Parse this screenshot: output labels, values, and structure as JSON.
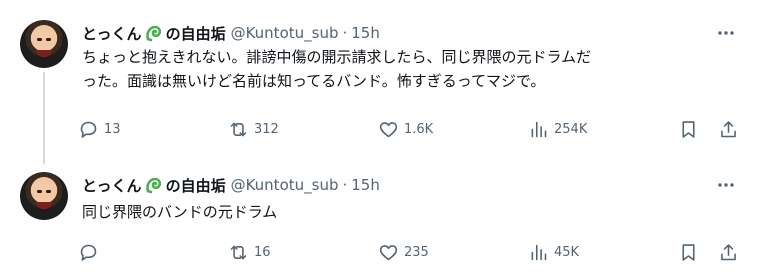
{
  "posts": [
    {
      "display_name": "とっくん",
      "name_suffix": "の自由垢",
      "name_emoji": "green-curly-emoji",
      "handle": "@Kuntotu_sub",
      "separator": "·",
      "time": "15h",
      "text_line1": "ちょっと抱えきれない。誹謗中傷の開示請求したら、同じ界隈の元ドラムだ",
      "text_line2": "った。面識は無いけど名前は知ってるバンド。怖すぎるってマジで。",
      "stats": {
        "replies": "13",
        "reposts": "312",
        "likes": "1.6K",
        "views": "254K"
      }
    },
    {
      "display_name": "とっくん",
      "name_suffix": "の自由垢",
      "name_emoji": "green-curly-emoji",
      "handle": "@Kuntotu_sub",
      "separator": "·",
      "time": "15h",
      "text_line1": "同じ界隈のバンドの元ドラム",
      "stats": {
        "replies": "",
        "reposts": "16",
        "likes": "235",
        "views": "45K"
      }
    }
  ],
  "icons": {
    "more": "more-horizontal-icon",
    "reply": "reply-icon",
    "repost": "repost-icon",
    "like": "heart-icon",
    "views": "views-chart-icon",
    "bookmark": "bookmark-icon",
    "share": "share-icon"
  },
  "colors": {
    "text": "#0f1419",
    "muted": "#536471",
    "thread_line": "#cfd9de",
    "emoji_green": "#4caf50"
  }
}
